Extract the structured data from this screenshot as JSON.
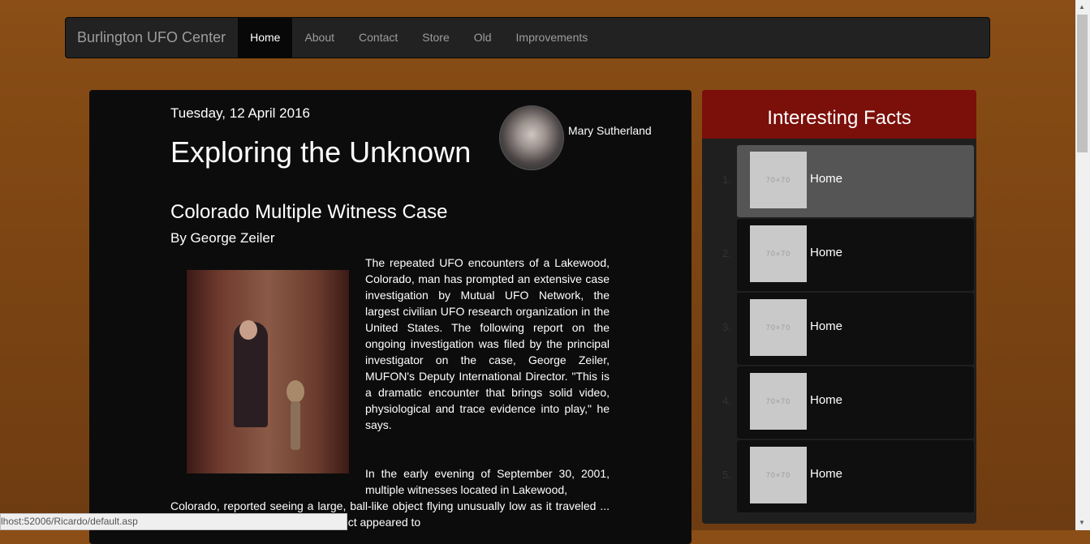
{
  "navbar": {
    "brand": "Burlington UFO Center",
    "items": [
      {
        "label": "Home",
        "active": true
      },
      {
        "label": "About"
      },
      {
        "label": "Contact"
      },
      {
        "label": "Store"
      },
      {
        "label": "Old"
      },
      {
        "label": "Improvements"
      }
    ]
  },
  "article": {
    "date": "Tuesday, 12 April 2016",
    "headline": "Exploring the Unknown",
    "author": "Mary Sutherland",
    "title": "Colorado Multiple Witness Case",
    "byline": "By George Zeiler",
    "paragraph1": "The repeated UFO encounters of a Lakewood, Colorado, man has prompted an extensive case investigation by Mutual UFO Network, the largest civilian UFO research organization in the United States. The following report on the ongoing investigation was filed by the principal investigator on the case, George Zeiler, MUFON's Deputy International Director. \"This is a dramatic encounter that brings solid video, physiological and trace evidence into play,\" he says.",
    "paragraph2_a": "In the early evening of September 30, 2001, multiple witnesses located in Lakewood,",
    "paragraph2_b": "Colorado, reported seeing a large, ball-like object flying unusually low as it traveled ... ng red, yellow and orange, the object appeared to"
  },
  "sidebar": {
    "title": "Interesting Facts",
    "items": [
      {
        "num": "1.",
        "thumb": "70×70",
        "label": "Home",
        "active": true
      },
      {
        "num": "2.",
        "thumb": "70×70",
        "label": "Home"
      },
      {
        "num": "3.",
        "thumb": "70×70",
        "label": "Home"
      },
      {
        "num": "4.",
        "thumb": "70×70",
        "label": "Home"
      },
      {
        "num": "5.",
        "thumb": "70×70",
        "label": "Home"
      }
    ]
  },
  "statusbar": {
    "url": "lhost:52006/Ricardo/default.asp"
  }
}
